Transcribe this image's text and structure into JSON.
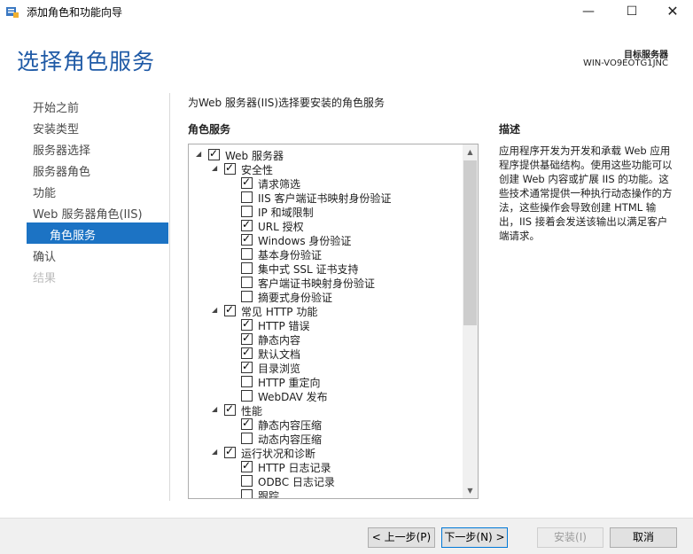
{
  "window": {
    "title": "添加角色和功能向导",
    "minimize": "—",
    "maximize": "☐",
    "close": "✕"
  },
  "header": {
    "page_title": "选择角色服务",
    "destination_label": "目标服务器",
    "destination_value": "WIN-VO9EOTG1JNC"
  },
  "nav": {
    "items": [
      {
        "label": "开始之前",
        "state": "normal"
      },
      {
        "label": "安装类型",
        "state": "normal"
      },
      {
        "label": "服务器选择",
        "state": "normal"
      },
      {
        "label": "服务器角色",
        "state": "normal"
      },
      {
        "label": "功能",
        "state": "normal"
      },
      {
        "label": "Web 服务器角色(IIS)",
        "state": "normal"
      },
      {
        "label": "角色服务",
        "state": "selected"
      },
      {
        "label": "确认",
        "state": "normal"
      },
      {
        "label": "结果",
        "state": "disabled"
      }
    ]
  },
  "main": {
    "intro": "为Web 服务器(IIS)选择要安装的角色服务",
    "roles_header": "角色服务",
    "description_header": "描述",
    "description_text": "应用程序开发为开发和承载 Web 应用程序提供基础结构。使用这些功能可以创建 Web 内容或扩展 IIS 的功能。这些技术通常提供一种执行动态操作的方法，这些操作会导致创建 HTML 输出，IIS 接着会发送该输出以满足客户端请求。"
  },
  "tree": {
    "items": [
      {
        "label": "Web 服务器",
        "level": 0,
        "checked": true,
        "expander": "◢"
      },
      {
        "label": "安全性",
        "level": 1,
        "checked": true,
        "expander": "◢"
      },
      {
        "label": "请求筛选",
        "level": 2,
        "checked": true
      },
      {
        "label": "IIS 客户端证书映射身份验证",
        "level": 2,
        "checked": false
      },
      {
        "label": "IP 和域限制",
        "level": 2,
        "checked": false
      },
      {
        "label": "URL 授权",
        "level": 2,
        "checked": true
      },
      {
        "label": "Windows 身份验证",
        "level": 2,
        "checked": true
      },
      {
        "label": "基本身份验证",
        "level": 2,
        "checked": false
      },
      {
        "label": "集中式 SSL 证书支持",
        "level": 2,
        "checked": false
      },
      {
        "label": "客户端证书映射身份验证",
        "level": 2,
        "checked": false
      },
      {
        "label": "摘要式身份验证",
        "level": 2,
        "checked": false
      },
      {
        "label": "常见 HTTP 功能",
        "level": 1,
        "checked": true,
        "expander": "◢"
      },
      {
        "label": "HTTP 错误",
        "level": 2,
        "checked": true
      },
      {
        "label": "静态内容",
        "level": 2,
        "checked": true
      },
      {
        "label": "默认文档",
        "level": 2,
        "checked": true
      },
      {
        "label": "目录浏览",
        "level": 2,
        "checked": true
      },
      {
        "label": "HTTP 重定向",
        "level": 2,
        "checked": false
      },
      {
        "label": "WebDAV 发布",
        "level": 2,
        "checked": false
      },
      {
        "label": "性能",
        "level": 1,
        "checked": true,
        "expander": "◢"
      },
      {
        "label": "静态内容压缩",
        "level": 2,
        "checked": true
      },
      {
        "label": "动态内容压缩",
        "level": 2,
        "checked": false
      },
      {
        "label": "运行状况和诊断",
        "level": 1,
        "checked": true,
        "expander": "◢"
      },
      {
        "label": "HTTP 日志记录",
        "level": 2,
        "checked": true
      },
      {
        "label": "ODBC 日志记录",
        "level": 2,
        "checked": false
      },
      {
        "label": "跟踪",
        "level": 2,
        "checked": false
      }
    ],
    "scroll_up": "▲",
    "scroll_down": "▼"
  },
  "footer": {
    "prev_label": "< 上一步(P)",
    "next_label": "下一步(N) >",
    "install_label": "安装(I)",
    "cancel_label": "取消"
  }
}
